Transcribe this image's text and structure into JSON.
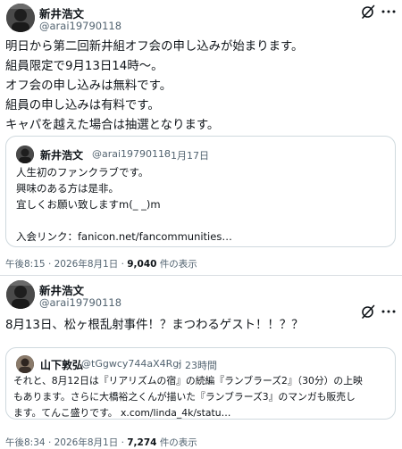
{
  "tweets": [
    {
      "author": {
        "name": "新井浩文",
        "handle": "@arai19790118"
      },
      "icons": {
        "grok": "grok-slash-icon",
        "more": "more-horizontal-icon"
      },
      "lines": [
        "明日から第二回新井組オフ会の申し込みが始まります。",
        "組員限定で9月13日14時〜。",
        "オフ会の申し込みは無料です。",
        "組員の申し込みは有料です。",
        "キャパを越えた場合は抽選となります。"
      ],
      "quote": {
        "name": "新井浩文",
        "handle": "@arai19790118",
        "sep": "·",
        "date": "1月17日",
        "lines": [
          "人生初のファンクラブです。",
          "興味のある方は是非。",
          "宜しくお願い致しますm(_ _)m",
          "",
          "入会リンク：fanicon.net/fancommunities…"
        ]
      },
      "footer": {
        "time": "午後8:15",
        "sep": "·",
        "date": "2026年8月1日",
        "views": "9,040",
        "views_label": "件の表示"
      }
    },
    {
      "author": {
        "name": "新井浩文",
        "handle": "@arai19790118"
      },
      "icons": {
        "grok": "grok-slash-icon",
        "more": "more-horizontal-icon"
      },
      "lines": [
        "8月13日、松ヶ根乱射事件！？まつわるゲスト！！？？"
      ],
      "quote": {
        "name": "山下敦弘",
        "handle": "@tGgwcy744aX4Rgj",
        "sep": "·",
        "date": "23時間",
        "lines": [
          "それと、8月12日は『リアリズムの宿』の続編『ランブラーズ2』（30分）の上映",
          "もあります。さらに大橋裕之くんが描いた『ランブラーズ3』のマンガも販売し",
          "ます。てんこ盛りです。 x.com/linda_4k/statu…"
        ]
      },
      "footer": {
        "time": "午後8:34",
        "sep": "·",
        "date": "2026年8月1日",
        "views": "7,274",
        "views_label": "件の表示"
      }
    }
  ]
}
